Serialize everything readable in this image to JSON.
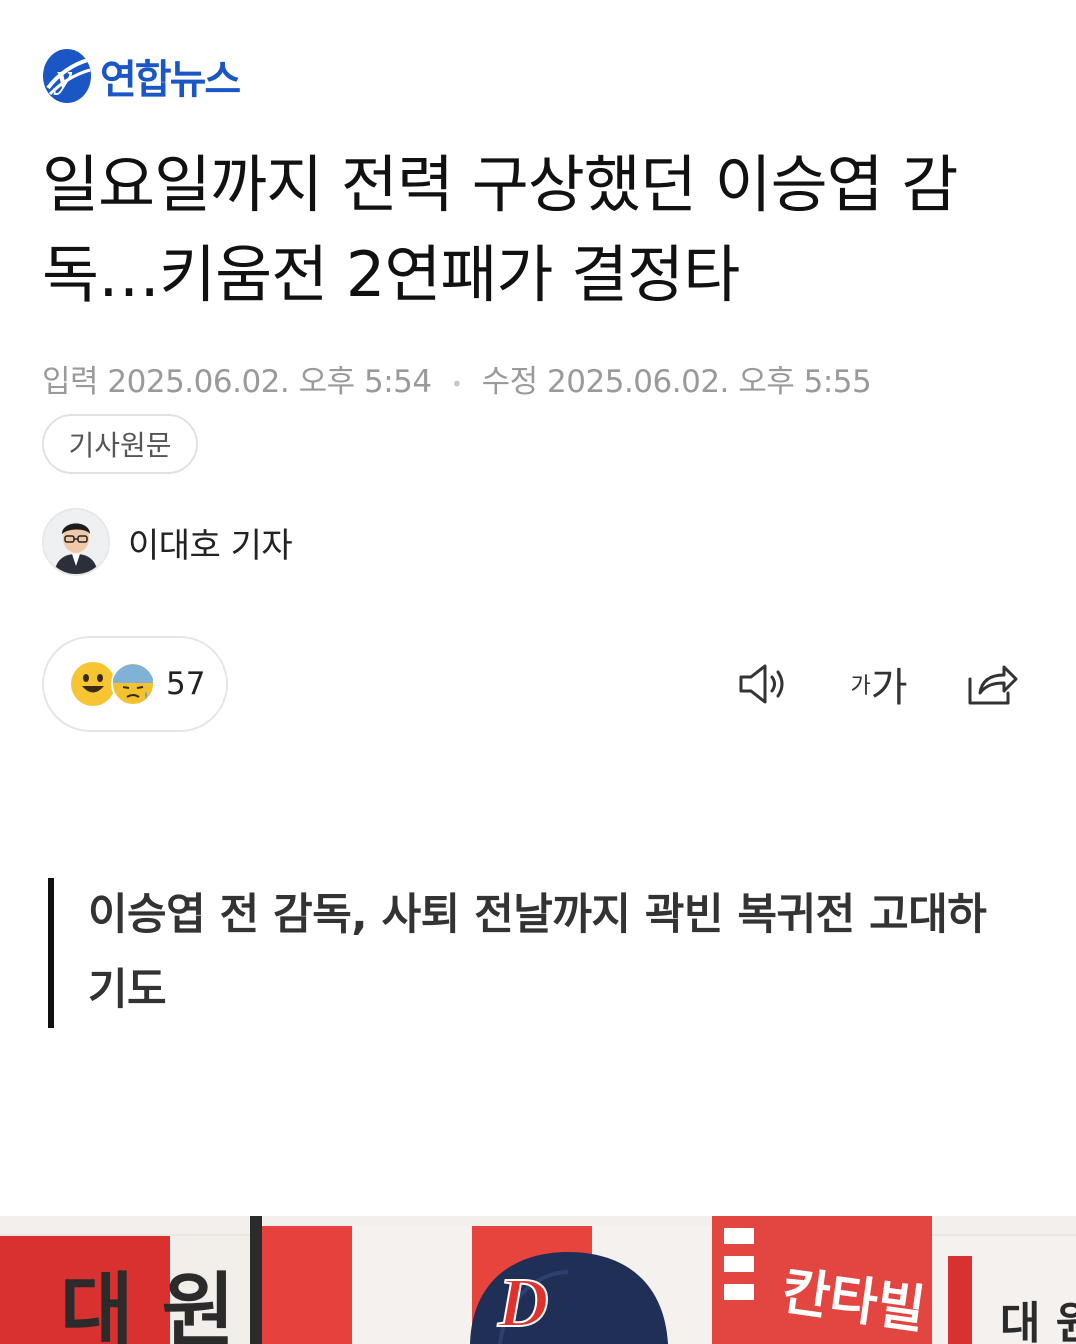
{
  "brand": {
    "name": "연합뉴스",
    "accent": "#1a56c4"
  },
  "article": {
    "headline": "일요일까지 전력 구상했던 이승엽 감독…키움전 2연패가 결정타",
    "input_label": "입력",
    "input_time": "2025.06.02. 오후 5:54",
    "edit_label": "수정",
    "edit_time": "2025.06.02. 오후 5:55",
    "source_button": "기사원문",
    "reporter": "이대호 기자",
    "subheadline": "이승엽 전 감독, 사퇴 전날까지 곽빈 복귀전 고대하기도"
  },
  "reactions": {
    "count": "57",
    "icons": [
      "smile-emoji",
      "sad-emoji"
    ]
  },
  "toolbar": {
    "audio_icon": "speaker-icon",
    "font_small": "가",
    "font_large": "가",
    "share_icon": "share-icon"
  },
  "photo": {
    "sign_left": "대 원",
    "sign_right": "칸타빌",
    "sign_far_right": "대 원",
    "cap_letter": "D"
  }
}
